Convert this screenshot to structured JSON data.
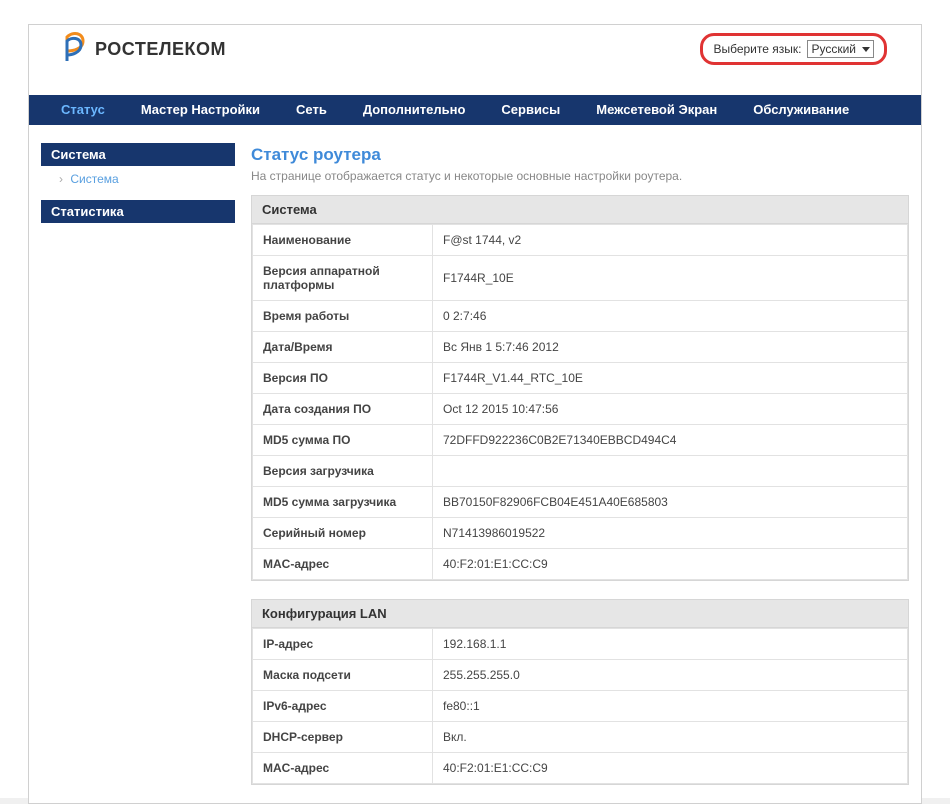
{
  "brand": {
    "name": "РОСТЕЛЕКОМ"
  },
  "language": {
    "label": "Выберите язык:",
    "value": "Русский"
  },
  "nav": {
    "items": [
      {
        "label": "Статус"
      },
      {
        "label": "Мастер Настройки"
      },
      {
        "label": "Сеть"
      },
      {
        "label": "Дополнительно"
      },
      {
        "label": "Сервисы"
      },
      {
        "label": "Межсетевой Экран"
      },
      {
        "label": "Обслуживание"
      }
    ]
  },
  "sidebar": {
    "group1": {
      "title": "Система",
      "item": "Система"
    },
    "group2": {
      "title": "Статистика"
    }
  },
  "page": {
    "title": "Статус роутера",
    "desc": "На странице отображается статус и некоторые основные настройки роутера."
  },
  "system_panel": {
    "title": "Система",
    "rows": [
      {
        "k": "Наименование",
        "v": "F@st 1744, v2"
      },
      {
        "k": "Версия аппаратной платформы",
        "v": "F1744R_10E"
      },
      {
        "k": "Время работы",
        "v": "0 2:7:46"
      },
      {
        "k": "Дата/Время",
        "v": "Вс Янв 1 5:7:46 2012"
      },
      {
        "k": "Версия ПО",
        "v": "F1744R_V1.44_RTC_10E"
      },
      {
        "k": "Дата создания ПО",
        "v": "Oct 12 2015 10:47:56"
      },
      {
        "k": "MD5 сумма ПО",
        "v": "72DFFD922236C0B2E71340EBBCD494C4"
      },
      {
        "k": "Версия загрузчика",
        "v": ""
      },
      {
        "k": "MD5 сумма загрузчика",
        "v": "BB70150F82906FCB04E451A40E685803"
      },
      {
        "k": "Серийный номер",
        "v": "N71413986019522"
      },
      {
        "k": "MAC-адрес",
        "v": "40:F2:01:E1:CC:C9"
      }
    ]
  },
  "lan_panel": {
    "title": "Конфигурация LAN",
    "rows": [
      {
        "k": "IP-адрес",
        "v": "192.168.1.1"
      },
      {
        "k": "Маска подсети",
        "v": "255.255.255.0"
      },
      {
        "k": "IPv6-адрес",
        "v": "fe80::1"
      },
      {
        "k": "DHCP-сервер",
        "v": "Вкл."
      },
      {
        "k": "MAC-адрес",
        "v": "40:F2:01:E1:CC:C9"
      }
    ]
  }
}
